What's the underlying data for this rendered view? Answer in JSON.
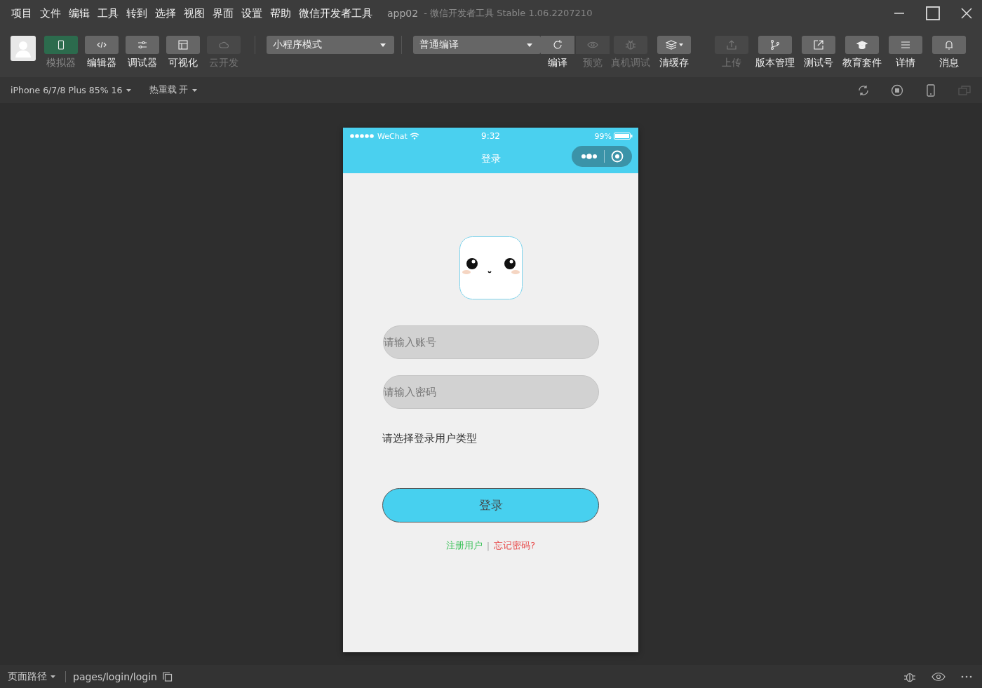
{
  "menu": [
    "项目",
    "文件",
    "编辑",
    "工具",
    "转到",
    "选择",
    "视图",
    "界面",
    "设置",
    "帮助",
    "微信开发者工具"
  ],
  "window": {
    "title": "app02",
    "subtitle": "-  微信开发者工具 Stable 1.06.2207210"
  },
  "toolbar": {
    "left_tools": [
      {
        "label": "模拟器",
        "selected": true,
        "disabled": false
      },
      {
        "label": "编辑器",
        "selected": false,
        "disabled": false
      },
      {
        "label": "调试器",
        "selected": false,
        "disabled": false
      },
      {
        "label": "可视化",
        "selected": false,
        "disabled": false
      },
      {
        "label": "云开发",
        "selected": false,
        "disabled": true
      }
    ],
    "mode_select": {
      "value": "小程序模式"
    },
    "compile_select": {
      "value": "普通编译"
    },
    "right_tools": [
      {
        "label": "编译",
        "kind": "attached",
        "disabled": false
      },
      {
        "label": "预览",
        "kind": "attached",
        "disabled": true
      },
      {
        "label": "真机调试",
        "kind": "button",
        "disabled": true
      },
      {
        "label": "清缓存",
        "kind": "dropdown",
        "disabled": false
      },
      {
        "label": "上传",
        "kind": "button",
        "disabled": true
      },
      {
        "label": "版本管理",
        "kind": "button",
        "disabled": false
      },
      {
        "label": "测试号",
        "kind": "button",
        "disabled": false
      },
      {
        "label": "教育套件",
        "kind": "button",
        "disabled": false
      },
      {
        "label": "详情",
        "kind": "button",
        "disabled": false
      },
      {
        "label": "消息",
        "kind": "button",
        "disabled": false
      }
    ]
  },
  "device_bar": {
    "device": "iPhone 6/7/8 Plus 85% 16",
    "hot_reload": "热重载 开"
  },
  "phone": {
    "carrier": "WeChat",
    "time": "9:32",
    "battery": "99%",
    "nav_title": "登录",
    "fields": [
      {
        "placeholder": "请输入账号"
      },
      {
        "placeholder": "请输入密码"
      }
    ],
    "user_type_label": "请选择登录用户类型",
    "login_button": "登录",
    "links": [
      {
        "label": "注册用户",
        "color": "#3cc25a"
      },
      {
        "label": "忘记密码?",
        "color": "#e84c4c"
      }
    ],
    "link_separator": "|"
  },
  "status_bar": {
    "path_label": "页面路径",
    "path": "pages/login/login"
  }
}
